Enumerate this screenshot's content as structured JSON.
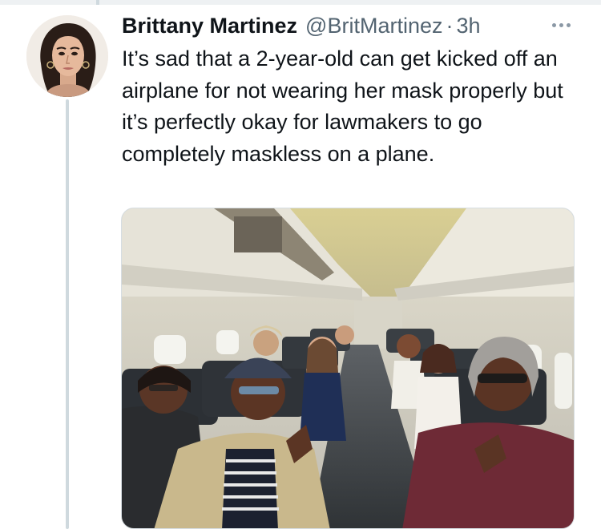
{
  "tweet": {
    "author": {
      "display_name": "Brittany Martinez",
      "handle": "@BritMartinez"
    },
    "separator": "·",
    "timestamp": "3h",
    "text": "It’s sad that a 2-year-old can get kicked off an airplane for not wearing her mask properly but it’s perfectly okay for lawmakers to go completely maskless on a plane.",
    "media": {
      "kind": "photo"
    }
  },
  "icons": {
    "more": "more-horizontal-icon"
  },
  "colors": {
    "text_primary": "#0f1419",
    "text_secondary": "#536471",
    "thread_line": "#cfd9de",
    "divider": "#eef1f3"
  }
}
